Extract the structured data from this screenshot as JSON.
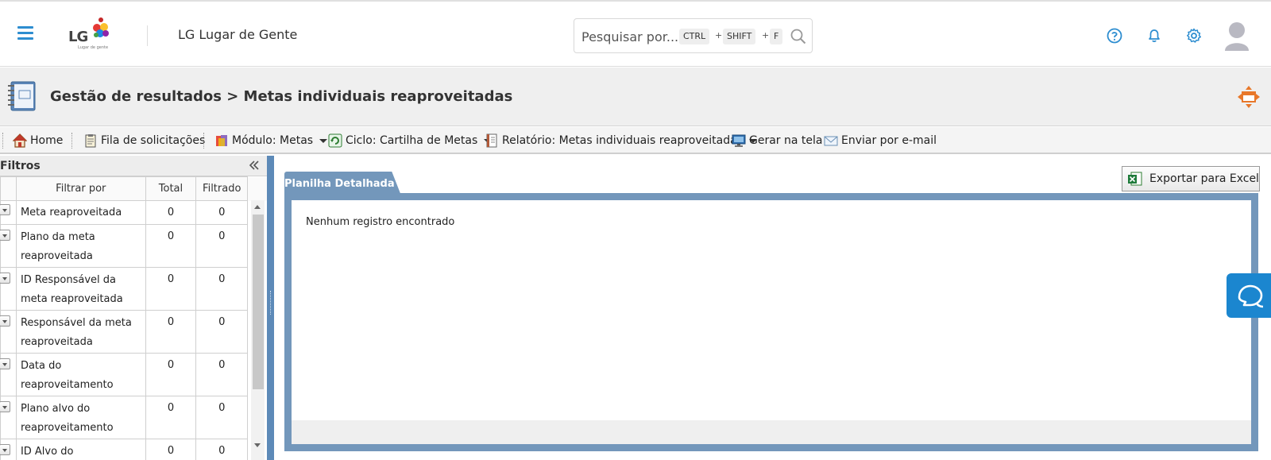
{
  "header": {
    "app_name": "LG Lugar de Gente",
    "logo_text": "LG",
    "logo_tagline": "Lugar de gente",
    "search": {
      "placeholder": "Pesquisar por...",
      "shortcut_keys": [
        "CTRL",
        "SHIFT",
        "F"
      ],
      "shortcut_separator": "+"
    },
    "icons": [
      "help-icon",
      "bell-icon",
      "gear-icon",
      "avatar"
    ]
  },
  "titlebar": {
    "title": "Gestão de resultados > Metas individuais reaproveitadas"
  },
  "toolbar": {
    "items": [
      {
        "label": "Home",
        "icon": "home-icon"
      },
      {
        "label": "Fila de solicitações",
        "icon": "clipboard-icon"
      },
      {
        "label": "Módulo: Metas",
        "icon": "module-icon",
        "dropdown": true
      },
      {
        "label": "Ciclo: Cartilha de Metas",
        "icon": "cycle-icon",
        "dropdown": true
      },
      {
        "label": "Relatório: Metas individuais reaproveitadas",
        "icon": "report-icon",
        "dropdown": true
      },
      {
        "label": "Gerar na tela",
        "icon": "monitor-icon"
      },
      {
        "label": "Enviar por e-mail",
        "icon": "email-icon"
      }
    ]
  },
  "filters": {
    "title": "Filtros",
    "columns": [
      "Filtrar por",
      "Total",
      "Filtrado"
    ],
    "rows": [
      {
        "label": "Meta reaproveitada",
        "total": "0",
        "filtered": "0"
      },
      {
        "label": "Plano da meta reaproveitada",
        "total": "0",
        "filtered": "0"
      },
      {
        "label": "ID Responsável da meta reaproveitada",
        "total": "0",
        "filtered": "0"
      },
      {
        "label": "Responsável da meta reaproveitada",
        "total": "0",
        "filtered": "0"
      },
      {
        "label": "Data do reaproveitamento",
        "total": "0",
        "filtered": "0"
      },
      {
        "label": "Plano alvo do reaproveitamento",
        "total": "0",
        "filtered": "0"
      },
      {
        "label": "ID Alvo do",
        "total": "0",
        "filtered": "0"
      }
    ]
  },
  "main": {
    "tab_label": "Planilha Detalhada",
    "export_label": "Exportar para Excel",
    "empty_message": "Nenhum registro encontrado"
  },
  "colors": {
    "accent_blue": "#2d8dd0",
    "panel_blue": "#7397bb",
    "chat_blue": "#1b86cf",
    "move_orange": "#e8782a"
  }
}
